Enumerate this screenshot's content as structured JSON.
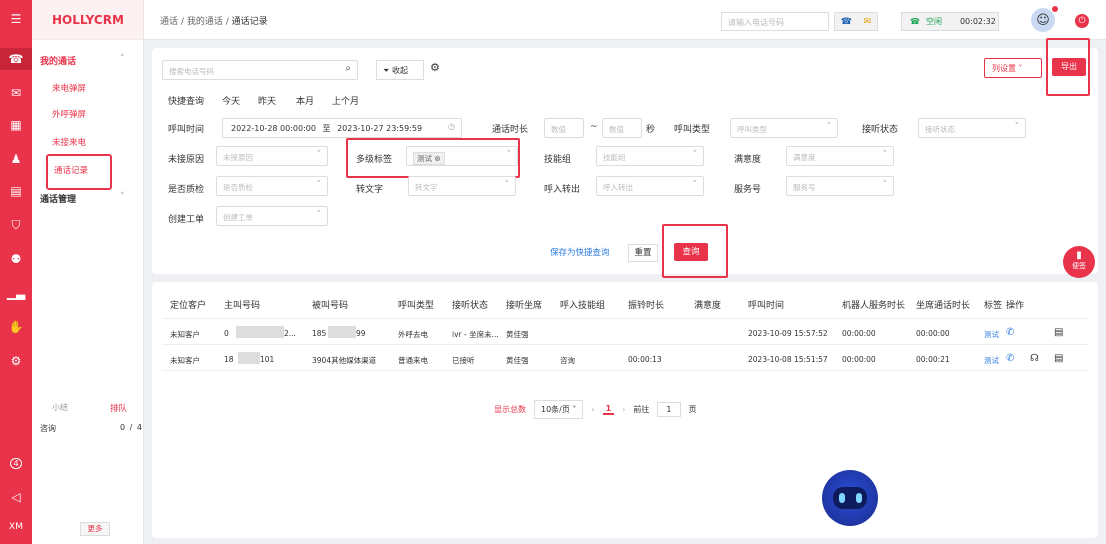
{
  "app": {
    "brand": "HOLLYCRM"
  },
  "rail": {
    "icons": [
      "menu-icon",
      "phone-icon",
      "chat-icon",
      "grid-icon",
      "user-icon",
      "clipboard-icon",
      "shield-icon",
      "robot-icon",
      "chart-icon",
      "handshake-icon",
      "gear-icon"
    ],
    "notif_count": "4",
    "bottom_label": "XM"
  },
  "sidebar": {
    "group1": "我的通话",
    "items": [
      "来电弹屏",
      "外呼弹屏",
      "未接来电",
      "通话记录"
    ],
    "group2": "通话管理",
    "queue_label": "小结",
    "queue_tab": "排队",
    "queue_name": "咨询",
    "queue_count": "0 / 4",
    "more": "更多"
  },
  "topbar": {
    "crumb1": "通话",
    "crumb2": "我的通话",
    "crumb3": "通话记录",
    "sep": "/",
    "phone_placeholder": "请输入电话号码",
    "status": "空闲",
    "timer": "00:02:32"
  },
  "filter": {
    "search_placeholder": "搜索电话号码",
    "fold": "收起",
    "colset": "列设置",
    "export": "导出",
    "quick_label": "快捷查询",
    "quick": [
      "今天",
      "昨天",
      "本月",
      "上个月"
    ],
    "call_time_label": "呼叫时间",
    "start": "2022-10-28 00:00:00",
    "to": "至",
    "end": "2023-10-27 23:59:59",
    "dur_label": "通话时长",
    "num_ph": "数值",
    "tilde": "~",
    "sec": "秒",
    "calltype_label": "呼叫类型",
    "calltype_ph": "呼叫类型",
    "answer_label": "接听状态",
    "answer_ph": "接听状态",
    "miss_label": "未接原因",
    "miss_ph": "未接原因",
    "tags_label": "多级标签",
    "tag_val": "测试",
    "skill_label": "技能组",
    "skill_ph": "技能组",
    "sat_label": "满意度",
    "sat_ph": "满意度",
    "qc_label": "是否质检",
    "qc_ph": "是否质检",
    "stt_label": "转文字",
    "stt_ph": "转文字",
    "transfer_label": "呼入转出",
    "transfer_ph": "呼入转出",
    "svc_label": "服务号",
    "svc_ph": "服务号",
    "ticket_label": "创建工单",
    "ticket_ph": "创建工单",
    "save_quick": "保存为快捷查询",
    "reset": "重置",
    "query": "查询",
    "note": "便签"
  },
  "table": {
    "headers": [
      "定位客户",
      "主叫号码",
      "被叫号码",
      "呼叫类型",
      "接听状态",
      "接听坐席",
      "呼入技能组",
      "振铃时长",
      "满意度",
      "呼叫时间",
      "机器人服务时长",
      "坐席通话时长",
      "标签",
      "操作"
    ],
    "rows": [
      [
        "未知客户",
        "0",
        "2...",
        "185",
        "99",
        "外呼去电",
        "ivr - 坐席未...",
        "黄佳强",
        "",
        "",
        "",
        "2023-10-09 15:57:52",
        "00:00:00",
        "00:00:00",
        "测试"
      ],
      [
        "未知客户",
        "18",
        "101",
        "",
        "",
        "3904其他媒体渠道",
        "普通来电",
        "已接听",
        "黄佳强",
        "咨询",
        "00:00:13",
        "2023-10-08 15:51:57",
        "00:00:00",
        "00:00:21",
        "测试"
      ]
    ]
  },
  "pagination": {
    "total": "显示总数",
    "size": "10条/页",
    "page": "1",
    "goto": "前往",
    "goto_val": "1",
    "page_unit": "页"
  }
}
